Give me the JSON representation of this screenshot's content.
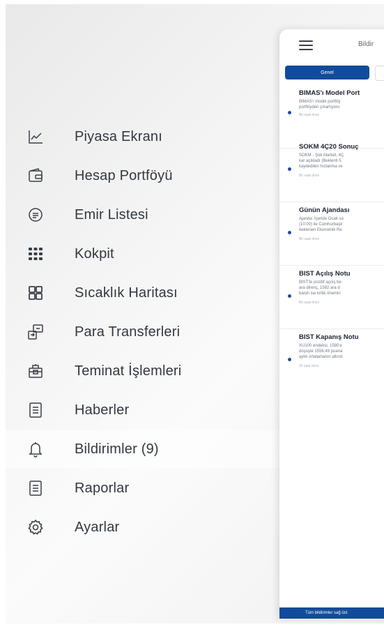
{
  "menu": {
    "items": [
      {
        "label": "Piyasa Ekranı",
        "icon": "chart-line-icon"
      },
      {
        "label": "Hesap Portföyü",
        "icon": "wallet-icon"
      },
      {
        "label": "Emir Listesi",
        "icon": "order-list-icon"
      },
      {
        "label": "Kokpit",
        "icon": "cockpit-grid-icon"
      },
      {
        "label": "Sıcaklık Haritası",
        "icon": "heatmap-icon"
      },
      {
        "label": "Para Transferleri",
        "icon": "money-transfer-icon"
      },
      {
        "label": "Teminat İşlemleri",
        "icon": "collateral-icon"
      },
      {
        "label": "Haberler",
        "icon": "news-icon"
      },
      {
        "label": "Bildirimler (9)",
        "icon": "bell-icon"
      },
      {
        "label": "Raporlar",
        "icon": "report-icon"
      },
      {
        "label": "Ayarlar",
        "icon": "settings-gear-icon"
      }
    ],
    "active_label": "Bildirimler (9)"
  },
  "panel": {
    "title": "Bildir",
    "tab_general": "Genel",
    "footer": "Tüm bildirimler sağ üst",
    "notifications": [
      {
        "title": "BIMAS'ı Model Port",
        "lines": [
          "BIMAS'ı model portföy",
          "portföyden çıkartıyoru"
        ],
        "time": "Bir saat önce"
      },
      {
        "title": "SOKM 4Ç20 Sonuç",
        "lines": [
          "SOKM - Şok Market, 4Ç",
          "kar açıkladı (Beklenti 5",
          "kaydedilen hızlanma ve"
        ],
        "time": "Bir saat önce"
      },
      {
        "title": "Günün Ajandası",
        "lines": [
          "Ajanda: İçeride Ocak sa",
          "(10:00) ile Cumhurbaşk",
          "beklenen Ekonomik Re"
        ],
        "time": "Bir saat önce"
      },
      {
        "title": "BIST Açılış Notu",
        "lines": [
          "BIST'te pozitif açılış be",
          "ara direnç, 1582 ara d",
          "bandı ise kritik önemin"
        ],
        "time": "Bir saat önce"
      },
      {
        "title": "BIST Kapanış Notu",
        "lines": [
          "XU100 endeksi, 1580'e",
          "düşüşle 1556.49 puana",
          "aylık ortalamanın altınd"
        ],
        "time": "16 saat önce"
      }
    ]
  },
  "colors": {
    "accent": "#114b9b",
    "unread_dot": "#1a4ea3",
    "menu_text": "#333840",
    "icon_stroke": "#3a3f47"
  }
}
